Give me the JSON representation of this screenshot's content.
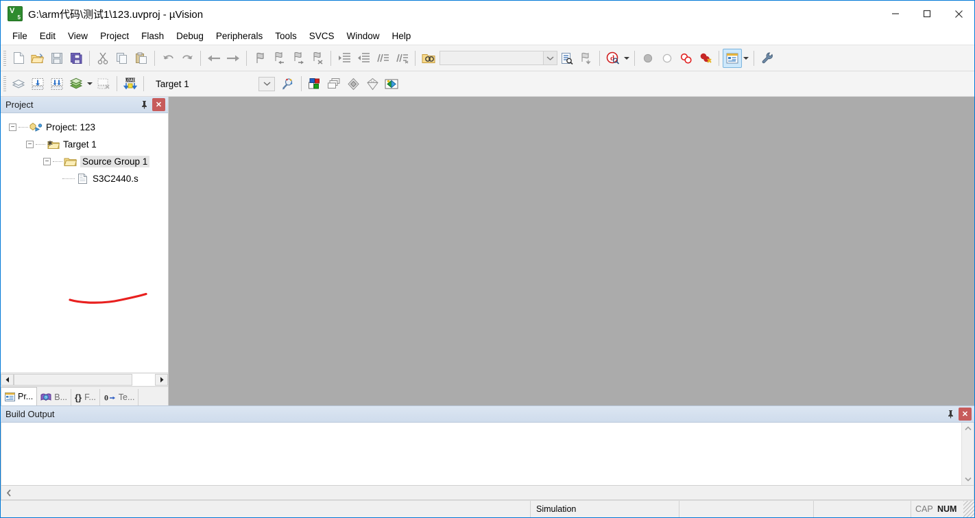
{
  "window": {
    "title": "G:\\arm代码\\测试1\\123.uvproj - µVision",
    "app_icon": "uvision-icon",
    "minimize_label": "—",
    "maximize_label": "□",
    "close_label": "✕"
  },
  "menu": {
    "items": [
      {
        "label": "File"
      },
      {
        "label": "Edit"
      },
      {
        "label": "View"
      },
      {
        "label": "Project"
      },
      {
        "label": "Flash"
      },
      {
        "label": "Debug"
      },
      {
        "label": "Peripherals"
      },
      {
        "label": "Tools"
      },
      {
        "label": "SVCS"
      },
      {
        "label": "Window"
      },
      {
        "label": "Help"
      }
    ]
  },
  "toolbar_main": {
    "buttons": [
      {
        "name": "new-file-icon",
        "title": "New"
      },
      {
        "name": "open-file-icon",
        "title": "Open"
      },
      {
        "name": "save-icon",
        "title": "Save"
      },
      {
        "name": "save-all-icon",
        "title": "Save All"
      },
      {
        "name": "cut-icon",
        "title": "Cut"
      },
      {
        "name": "copy-icon",
        "title": "Copy"
      },
      {
        "name": "paste-icon",
        "title": "Paste"
      },
      {
        "name": "undo-icon",
        "title": "Undo"
      },
      {
        "name": "redo-icon",
        "title": "Redo"
      },
      {
        "name": "back-icon",
        "title": "Navigate Backwards"
      },
      {
        "name": "forward-icon",
        "title": "Navigate Forwards"
      },
      {
        "name": "bookmark-toggle-icon",
        "title": "Insert/Remove Bookmark"
      },
      {
        "name": "bookmark-prev-icon",
        "title": "Previous Bookmark"
      },
      {
        "name": "bookmark-next-icon",
        "title": "Next Bookmark"
      },
      {
        "name": "bookmark-clear-icon",
        "title": "Clear All Bookmarks"
      },
      {
        "name": "indent-icon",
        "title": "Indent Selected Text"
      },
      {
        "name": "outdent-icon",
        "title": "Unindent Selected Text"
      },
      {
        "name": "comment-icon",
        "title": "Comment Selection"
      },
      {
        "name": "uncomment-icon",
        "title": "Uncomment Selection"
      },
      {
        "name": "find-in-files-icon",
        "title": "Find in Files"
      },
      {
        "name": "find-icon",
        "title": "Find"
      },
      {
        "name": "bookmark-list-icon",
        "title": "Bookmarks"
      },
      {
        "name": "start-debug-icon",
        "title": "Start/Stop Debug Session"
      },
      {
        "name": "breakpoint-insert-icon",
        "title": "Insert/Remove Breakpoint"
      },
      {
        "name": "breakpoint-disable-icon",
        "title": "Enable/Disable Breakpoint"
      },
      {
        "name": "breakpoint-disable-all-icon",
        "title": "Disable All Breakpoints"
      },
      {
        "name": "breakpoint-kill-all-icon",
        "title": "Kill All Breakpoints"
      },
      {
        "name": "project-window-icon",
        "title": "Project Window"
      },
      {
        "name": "configure-icon",
        "title": "Configuration Wizard"
      }
    ],
    "search_box": {
      "value": "",
      "placeholder": ""
    }
  },
  "toolbar_build": {
    "buttons": [
      {
        "name": "translate-icon",
        "title": "Translate Current File"
      },
      {
        "name": "build-icon",
        "title": "Build"
      },
      {
        "name": "rebuild-icon",
        "title": "Rebuild All Target Files"
      },
      {
        "name": "batch-build-icon",
        "title": "Batch Build"
      },
      {
        "name": "stop-build-icon",
        "title": "Stop Build"
      },
      {
        "name": "download-icon",
        "title": "Download"
      }
    ],
    "target_combo": {
      "value": "Target 1"
    },
    "right_buttons": [
      {
        "name": "target-options-icon",
        "title": "Options for Target"
      },
      {
        "name": "manage-components-icon",
        "title": "Manage Project Items"
      },
      {
        "name": "manage-multi-project-icon",
        "title": "Manage Multi-Project Workspace"
      },
      {
        "name": "pack-installer-icon",
        "title": "Pack Installer"
      },
      {
        "name": "run-utility-icon",
        "title": "Manage Run-Time Environment"
      },
      {
        "name": "pack-manager-icon",
        "title": "Pack Installer"
      }
    ]
  },
  "project_panel": {
    "title": "Project",
    "pin_label": "pin",
    "close_label": "✕",
    "tree": [
      {
        "label": "Project: 123",
        "icon": "project-icon",
        "depth": 0,
        "expanded": true,
        "selected": false
      },
      {
        "label": "Target 1",
        "icon": "target-icon",
        "depth": 1,
        "expanded": true,
        "selected": false
      },
      {
        "label": "Source Group 1",
        "icon": "folder-icon",
        "depth": 2,
        "expanded": true,
        "selected": true
      },
      {
        "label": "S3C2440.s",
        "icon": "source-file-icon",
        "depth": 3,
        "expanded": false,
        "selected": false
      }
    ],
    "annotation": {
      "type": "red-underline",
      "color": "#e8201f",
      "target": "S3C2440.s"
    },
    "tabs": [
      {
        "label": "Pr...",
        "icon": "project-tab-icon",
        "active": true
      },
      {
        "label": "B...",
        "icon": "books-tab-icon",
        "active": false
      },
      {
        "label": "F...",
        "icon": "functions-tab-icon",
        "active": false
      },
      {
        "label": "Te...",
        "icon": "templates-tab-icon",
        "active": false
      }
    ],
    "tab_icon_glyphs": {
      "functions": "{}",
      "templates": "0"
    }
  },
  "editor": {
    "background": "#ababab",
    "content": ""
  },
  "build_output": {
    "title": "Build Output",
    "pin_label": "pin",
    "close_label": "✕",
    "content": "",
    "scroll_up": "▲",
    "scroll_down": "▼",
    "scroll_left": "◄"
  },
  "status_bar": {
    "message": "",
    "mode": "Simulation",
    "field_1": "",
    "field_2": "",
    "caps": "CAP",
    "num": "NUM"
  },
  "colors": {
    "window_border": "#0078d7",
    "editor_bg": "#ababab",
    "panel_header": "#d7e2ef",
    "annotation_red": "#e8201f",
    "close_red": "#c75b5b"
  }
}
